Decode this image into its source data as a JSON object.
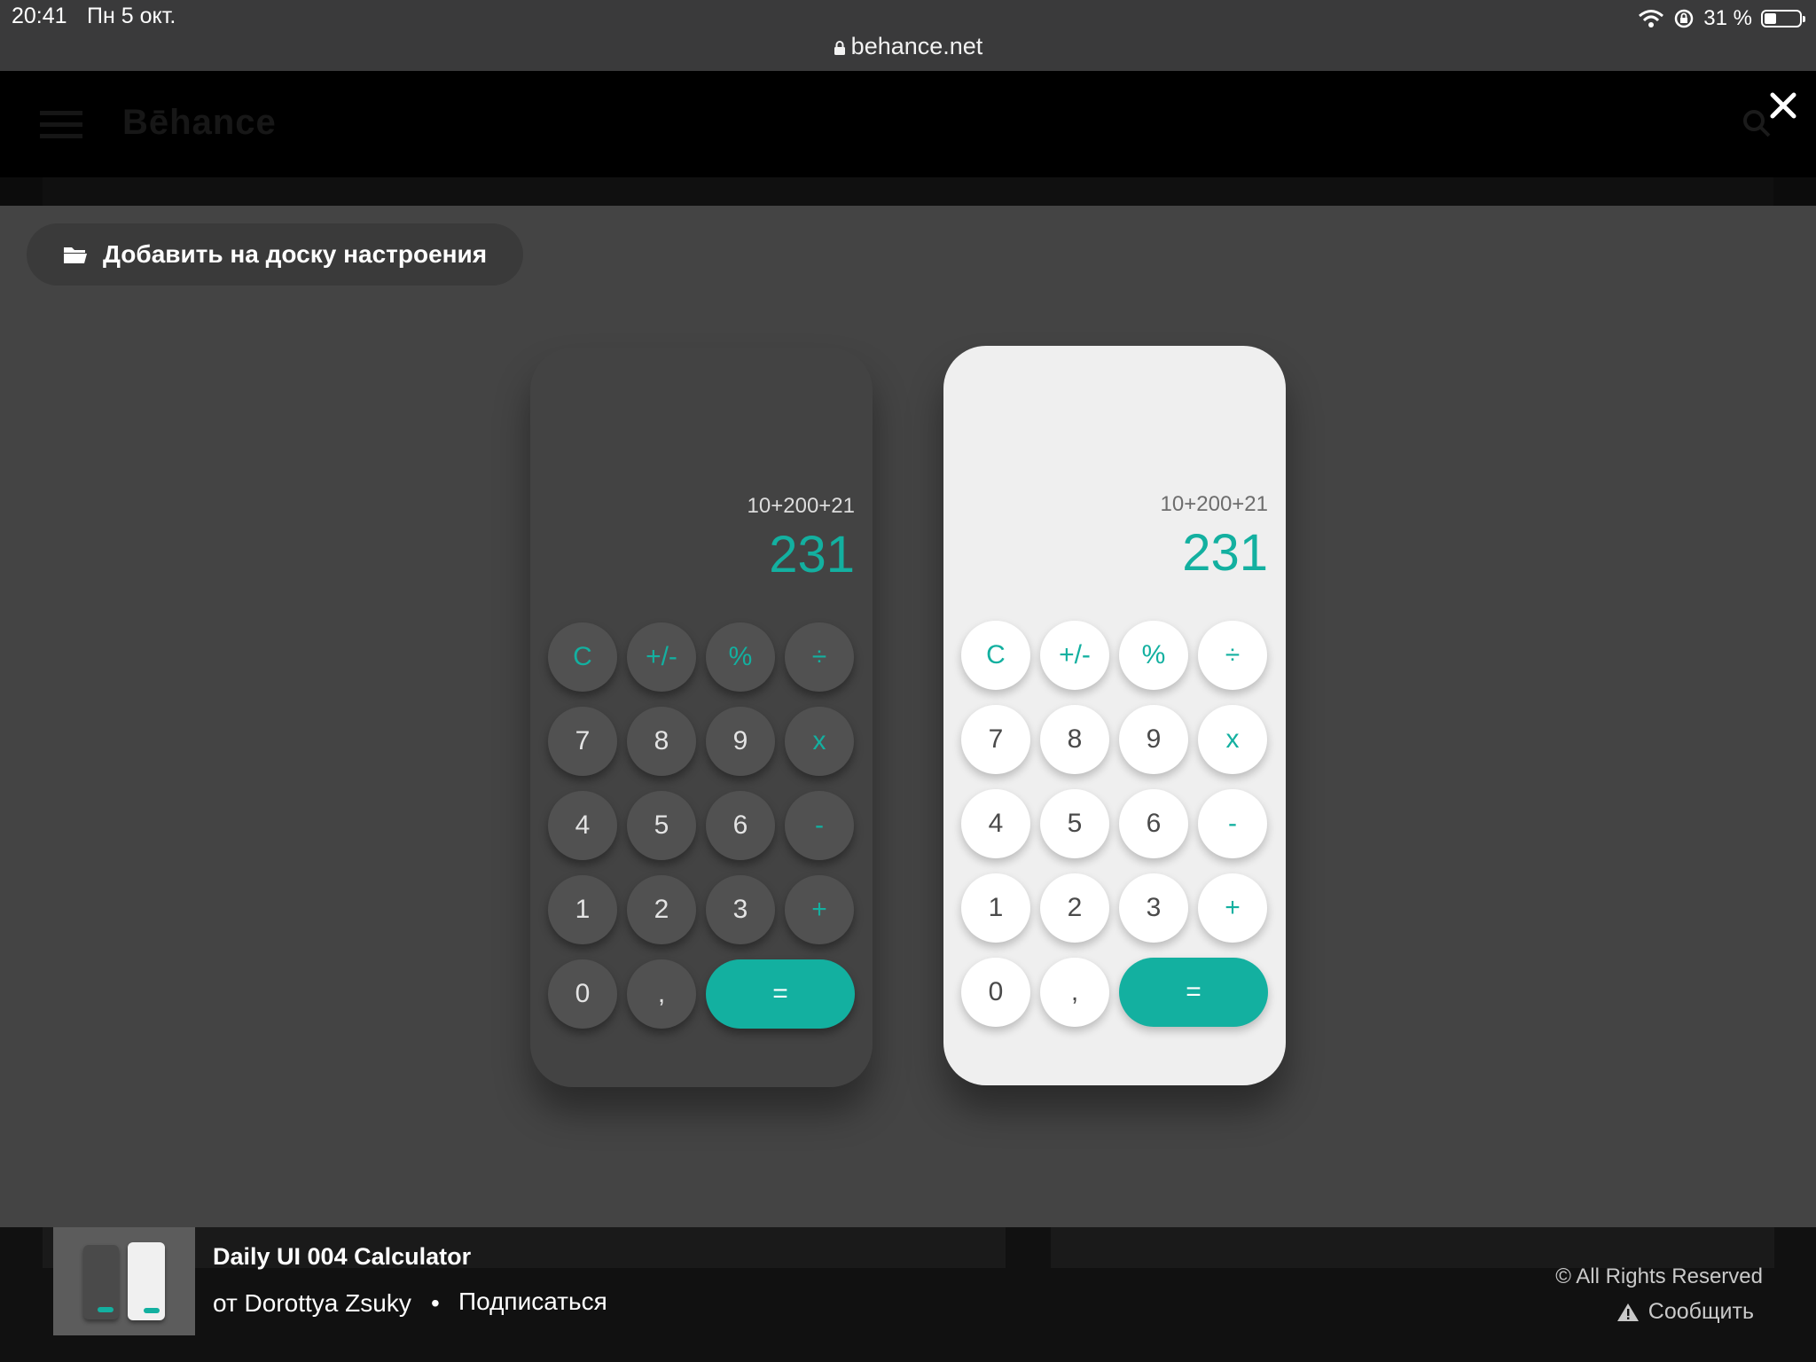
{
  "status_bar": {
    "time": "20:41",
    "date": "Пн 5 окт.",
    "url": "behance.net",
    "battery": "31 %"
  },
  "header": {
    "logo": "Bēhance"
  },
  "modal": {
    "moodboard_label": "Добавить на доску настроения"
  },
  "calc_dark": {
    "expression": "10+200+21",
    "result": "231",
    "keys": [
      "C",
      "+/-",
      "%",
      "÷",
      "7",
      "8",
      "9",
      "x",
      "4",
      "5",
      "6",
      "-",
      "1",
      "2",
      "3",
      "+",
      "0",
      ",",
      "="
    ]
  },
  "calc_light": {
    "expression": "10+200+21",
    "result": "231",
    "keys": [
      "C",
      "+/-",
      "%",
      "÷",
      "7",
      "8",
      "9",
      "x",
      "4",
      "5",
      "6",
      "-",
      "1",
      "2",
      "3",
      "+",
      "0",
      ",",
      "="
    ]
  },
  "footer": {
    "title": "Daily UI 004 Calculator",
    "author": "от Dorottya Zsuky",
    "separator": "•",
    "follow": "Подписаться",
    "rights": "© All Rights Reserved",
    "report": "Сообщить"
  },
  "colors": {
    "accent": "#13b0a0",
    "dark_panel": "#434343",
    "light_panel": "#efefef"
  }
}
